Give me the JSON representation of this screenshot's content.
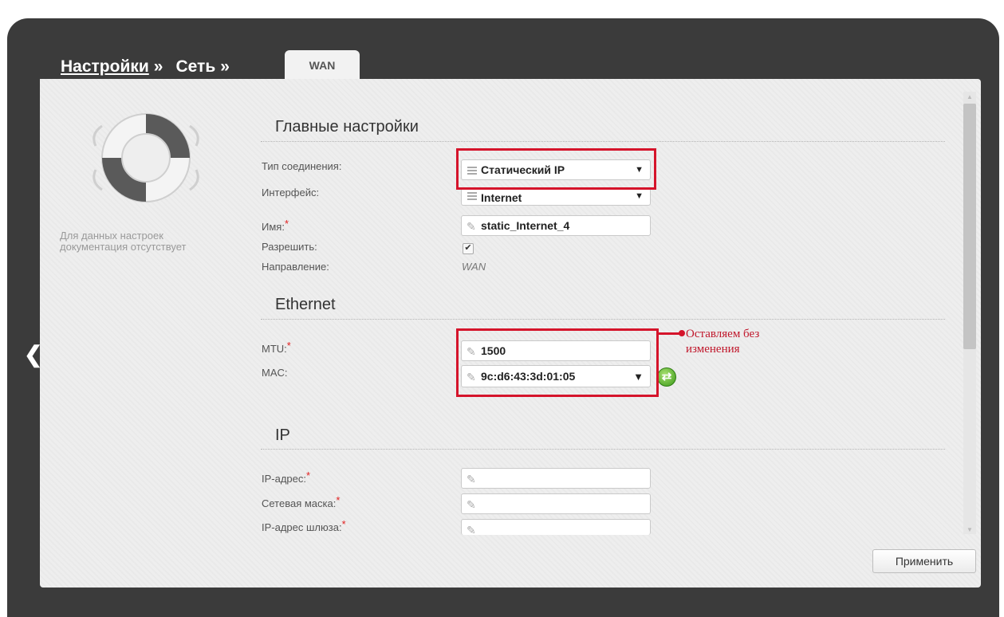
{
  "breadcrumb": {
    "root": "Настройки",
    "sep1": "»",
    "second": "Сеть",
    "sep2": "»",
    "active_tab": "WAN"
  },
  "help": {
    "text": "Для данных настроек документация отсутствует"
  },
  "sections": {
    "main": "Главные настройки",
    "ethernet": "Ethernet",
    "ip": "IP"
  },
  "fields": {
    "conn_type": {
      "label": "Тип соединения:",
      "value": "Статический IP"
    },
    "interface": {
      "label": "Интерфейс:",
      "value": "Internet"
    },
    "name": {
      "label": "Имя:",
      "value": "static_Internet_4"
    },
    "enable": {
      "label": "Разрешить:",
      "checked": true
    },
    "direction": {
      "label": "Направление:",
      "value": "WAN"
    },
    "mtu": {
      "label": "MTU:",
      "value": "1500"
    },
    "mac": {
      "label": "MAC:",
      "value": "9c:d6:43:3d:01:05"
    },
    "ip_address": {
      "label": "IP-адрес:",
      "value": ""
    },
    "netmask": {
      "label": "Сетевая маска:",
      "value": ""
    },
    "gateway": {
      "label": "IP-адрес шлюза:",
      "value": ""
    }
  },
  "required_mark": "*",
  "annotation": "Оставляем без изменения",
  "apply_button": "Применить",
  "icons": {
    "back": "chevron-left-icon",
    "help": "lifebuoy-icon",
    "edit": "pencil-icon",
    "list": "list-icon",
    "refresh": "refresh-icon"
  },
  "colors": {
    "frame": "#3b3b3b",
    "panel": "#eeeeee",
    "highlight": "#d5142b",
    "annotation": "#c0162a"
  }
}
